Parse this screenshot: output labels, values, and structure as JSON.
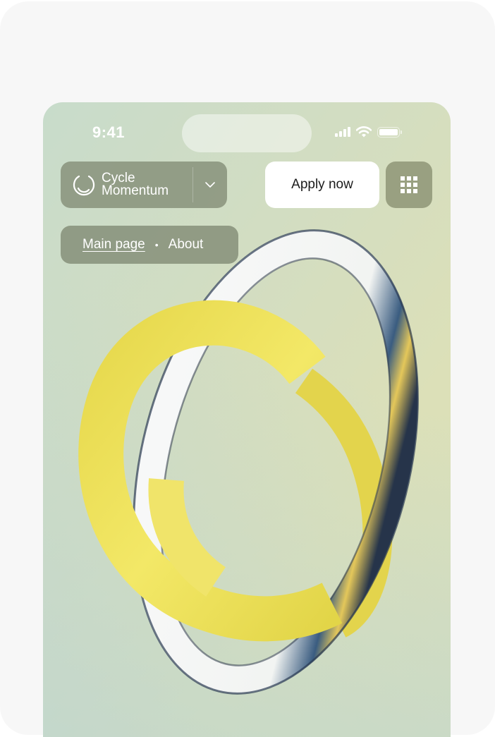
{
  "status_bar": {
    "time": "9:41",
    "icons": [
      "signal-icon",
      "wifi-icon",
      "battery-icon"
    ]
  },
  "header": {
    "brand": {
      "line1": "Cycle",
      "line2": "Momentum",
      "logo": "cycle-logo-icon",
      "menu_icon": "chevron-down-icon"
    },
    "apply_label": "Apply now",
    "grid_menu_icon": "grid-menu-icon"
  },
  "breadcrumb": {
    "items": [
      {
        "label": "Main page"
      },
      {
        "label": "About"
      }
    ],
    "separator": "•"
  },
  "hero": {
    "description": "3D rings illustration: yellow ring and iridescent glass ring"
  },
  "colors": {
    "brand_chip": "#8a947d",
    "accent_yellow": "#f2e45a",
    "button_bg": "#ffffff"
  }
}
